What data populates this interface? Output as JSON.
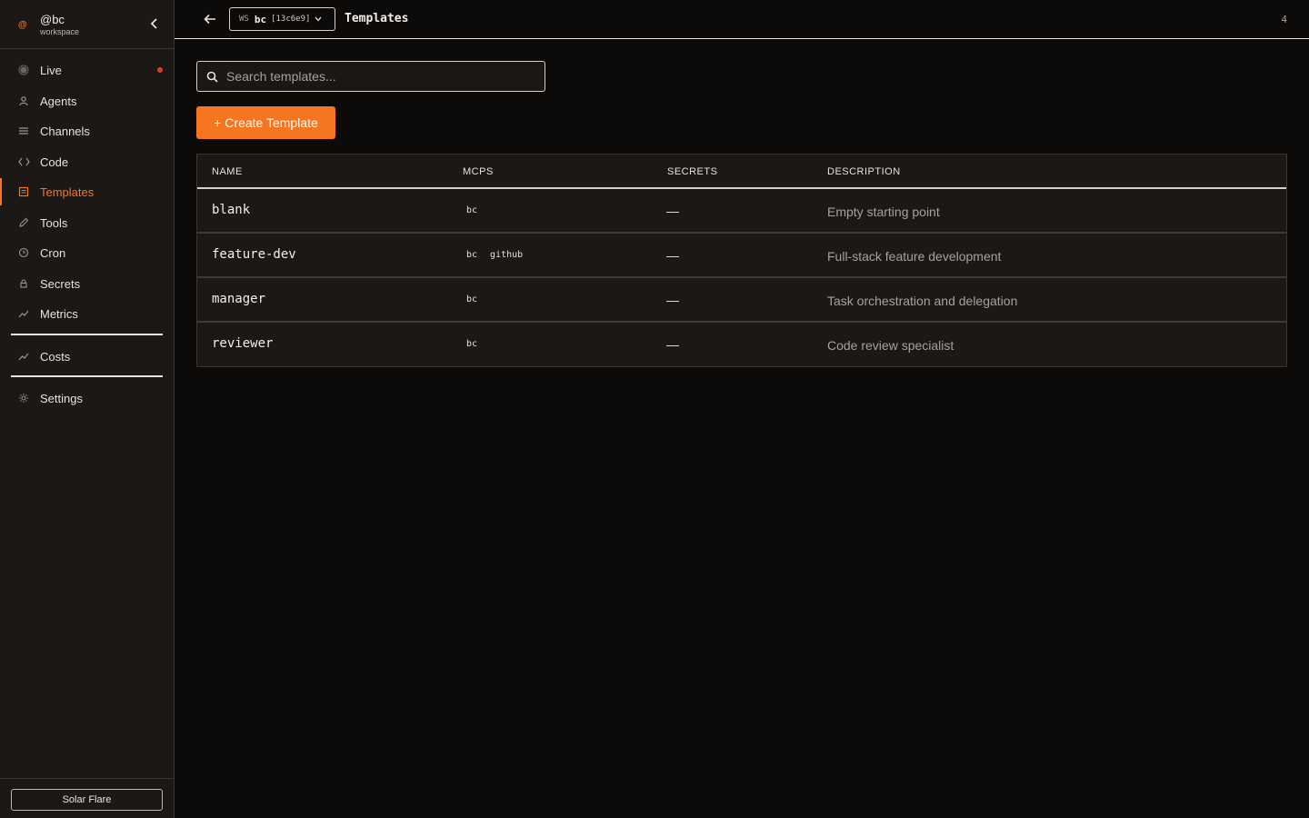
{
  "workspace": {
    "mark": "@",
    "name": "@bc",
    "subtitle": "workspace"
  },
  "sidebar": {
    "items": [
      {
        "label": "Live",
        "icon": "live-icon"
      },
      {
        "label": "Agents",
        "icon": "user-icon"
      },
      {
        "label": "Channels",
        "icon": "menu-icon"
      },
      {
        "label": "Code",
        "icon": "code-icon"
      },
      {
        "label": "Templates",
        "icon": "template-icon",
        "active": true
      },
      {
        "label": "Tools",
        "icon": "pencil-icon"
      },
      {
        "label": "Cron",
        "icon": "clock-icon"
      },
      {
        "label": "Secrets",
        "icon": "lock-icon"
      },
      {
        "label": "Metrics",
        "icon": "trend-icon"
      },
      {
        "label": "Costs",
        "icon": "trend-icon"
      },
      {
        "label": "Settings",
        "icon": "gear-icon"
      }
    ],
    "theme_label": "Solar Flare"
  },
  "header": {
    "ws_tag": "WS",
    "ws_name": "bc",
    "ws_id": "[13c6e9]",
    "title": "Templates",
    "count": "4"
  },
  "search": {
    "placeholder": "Search templates..."
  },
  "create_button": "+ Create Template",
  "table": {
    "columns": [
      "NAME",
      "MCPS",
      "SECRETS",
      "DESCRIPTION"
    ],
    "rows": [
      {
        "name": "blank",
        "mcps": [
          "bc"
        ],
        "secrets": "—",
        "description": "Empty starting point"
      },
      {
        "name": "feature-dev",
        "mcps": [
          "bc",
          "github"
        ],
        "secrets": "—",
        "description": "Full-stack feature development"
      },
      {
        "name": "manager",
        "mcps": [
          "bc"
        ],
        "secrets": "—",
        "description": "Task orchestration and delegation"
      },
      {
        "name": "reviewer",
        "mcps": [
          "bc"
        ],
        "secrets": "—",
        "description": "Code review specialist"
      }
    ]
  },
  "colors": {
    "accent": "#f57521",
    "background": "#0d0b0a",
    "sidebar": "#1b1816",
    "live_dot": "#d9402c"
  }
}
